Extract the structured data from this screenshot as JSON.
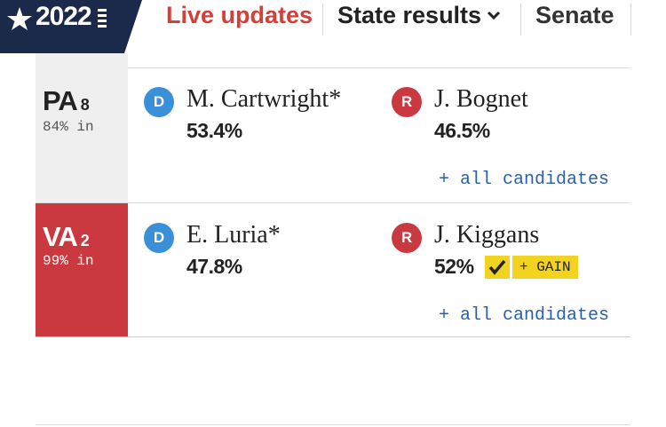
{
  "nav": {
    "year": "2022",
    "live_updates": "Live updates",
    "state_results": "State results",
    "senate": "Senate"
  },
  "colors": {
    "democrat": "#3a8fd9",
    "republican": "#c9393f",
    "accent": "#d43f3a",
    "gain": "#f2d31f",
    "logo_bg": "#1b2a4a"
  },
  "races": [
    {
      "state": "PA",
      "district": "8",
      "reporting": "84% in",
      "winner_party": null,
      "candidates": [
        {
          "party": "D",
          "name": "M. Cartwright*",
          "pct": "53.4%"
        },
        {
          "party": "R",
          "name": "J. Bognet",
          "pct": "46.5%"
        }
      ],
      "all_candidates_link": "+ all candidates"
    },
    {
      "state": "VA",
      "district": "2",
      "reporting": "99% in",
      "winner_party": "R",
      "candidates": [
        {
          "party": "D",
          "name": "E. Luria*",
          "pct": "47.8%"
        },
        {
          "party": "R",
          "name": "J. Kiggans",
          "pct": "52%",
          "winner": true,
          "gain_label": "+ GAIN"
        }
      ],
      "all_candidates_link": "+ all candidates"
    }
  ]
}
